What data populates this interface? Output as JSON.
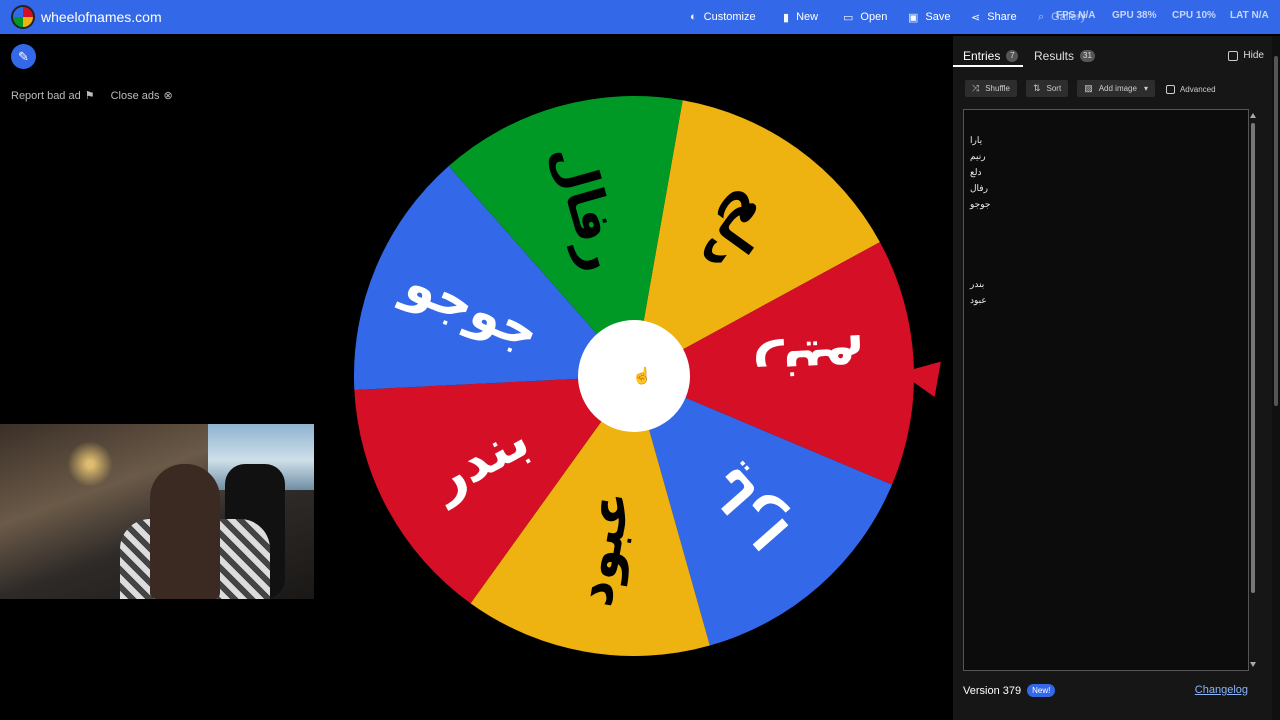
{
  "header": {
    "site_title": "wheelofnames.com",
    "nav": [
      {
        "icon": "palette-icon",
        "glyph": "◐",
        "label": "Customize"
      },
      {
        "icon": "file-icon",
        "glyph": "▮",
        "label": "New"
      },
      {
        "icon": "folder-icon",
        "glyph": "▭",
        "label": "Open"
      },
      {
        "icon": "save-icon",
        "glyph": "▣",
        "label": "Save"
      },
      {
        "icon": "share-icon",
        "glyph": "⋖",
        "label": "Share"
      },
      {
        "icon": "search-icon",
        "glyph": "⌕",
        "label": "Gallery"
      }
    ],
    "overlay_stats": [
      "FPS N/A",
      "GPU 38%",
      "CPU 10%",
      "LAT N/A"
    ]
  },
  "ads": {
    "report_label": "Report bad ad",
    "close_label": "Close ads"
  },
  "wheel": {
    "segments": [
      {
        "label": "دلع",
        "color": "#eeb211"
      },
      {
        "label": "رنيم",
        "color": "#d50f25"
      },
      {
        "label": "يارا",
        "color": "#3369e8"
      },
      {
        "label": "عبود",
        "color": "#eeb211"
      },
      {
        "label": "بندر",
        "color": "#d50f25"
      },
      {
        "label": "جوجو",
        "color": "#3369e8"
      },
      {
        "label": "رفال",
        "color": "#009925"
      }
    ],
    "pointer_color": "#d50f25"
  },
  "panel": {
    "tabs": [
      {
        "label": "Entries",
        "count": "7"
      },
      {
        "label": "Results",
        "count": "31"
      }
    ],
    "hide_label": "Hide",
    "toolbar": {
      "shuffle": "Shuffle",
      "sort": "Sort",
      "add_image": "Add image",
      "advanced": "Advanced"
    },
    "entries": [
      "يارا",
      "رنيم",
      "دلع",
      "رفال",
      "جوجو",
      "",
      "",
      "",
      "",
      "بندر",
      "عبود"
    ],
    "version": "Version 379",
    "new_badge": "New!",
    "changelog": "Changelog"
  }
}
